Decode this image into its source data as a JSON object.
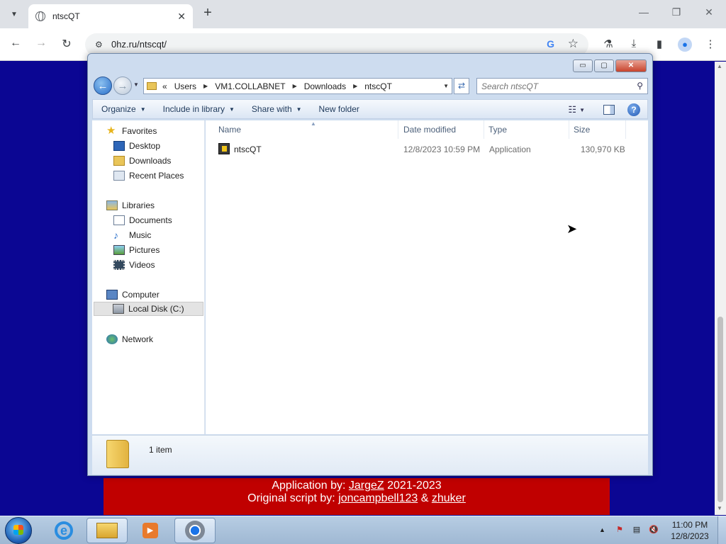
{
  "browser": {
    "tab_title": "ntscQT",
    "tab_close": "✕",
    "new_tab": "+",
    "url": "0hz.ru/ntscqt/",
    "google_g": "G",
    "win_min": "—",
    "win_restore": "❐",
    "win_close": "✕",
    "icons": [
      "tab-search-icon",
      "globe-icon",
      "back-icon",
      "forward-icon",
      "reload-icon",
      "site-info-icon",
      "google-lens-icon",
      "bookmark-star-icon",
      "labs-icon",
      "download-icon",
      "side-panel-icon",
      "profile-icon",
      "menu-icon"
    ]
  },
  "page": {
    "footer_line1_prefix": "Application by: ",
    "footer_author1": "JargeZ",
    "footer_line1_suffix": " 2021-2023",
    "footer_line2_prefix": "Original script by: ",
    "footer_author2": "joncampbell123",
    "footer_amp": " & ",
    "footer_author3": "zhuker",
    "banner_color": "#c00000",
    "background_color": "#0b0693"
  },
  "explorer": {
    "caption": {
      "minimize": "▭",
      "maximize": "▢",
      "close": "✕"
    },
    "breadcrumb": {
      "overflow": "«",
      "items": [
        "Users",
        "VM1.COLLABNET",
        "Downloads",
        "ntscQT"
      ]
    },
    "search_placeholder": "Search ntscQT",
    "commands": {
      "organize": "Organize",
      "include_in_library": "Include in library",
      "share_with": "Share with",
      "new_folder": "New folder"
    },
    "nav": {
      "favorites": "Favorites",
      "desktop": "Desktop",
      "downloads": "Downloads",
      "recent_places": "Recent Places",
      "libraries": "Libraries",
      "documents": "Documents",
      "music": "Music",
      "pictures": "Pictures",
      "videos": "Videos",
      "computer": "Computer",
      "local_disk": "Local Disk (C:)",
      "network": "Network"
    },
    "columns": {
      "name": "Name",
      "date_modified": "Date modified",
      "type": "Type",
      "size": "Size"
    },
    "files": [
      {
        "name": "ntscQT",
        "date_modified": "12/8/2023 10:59 PM",
        "type": "Application",
        "size": "130,970 KB"
      }
    ],
    "status": "1 item"
  },
  "taskbar": {
    "clock_time": "11:00 PM",
    "clock_date": "12/8/2023",
    "ie_letter": "e",
    "media_glyph": "▶",
    "tray_up": "▲",
    "tray_icons": [
      "action-center-flag-icon",
      "network-icon",
      "volume-muted-icon"
    ]
  }
}
